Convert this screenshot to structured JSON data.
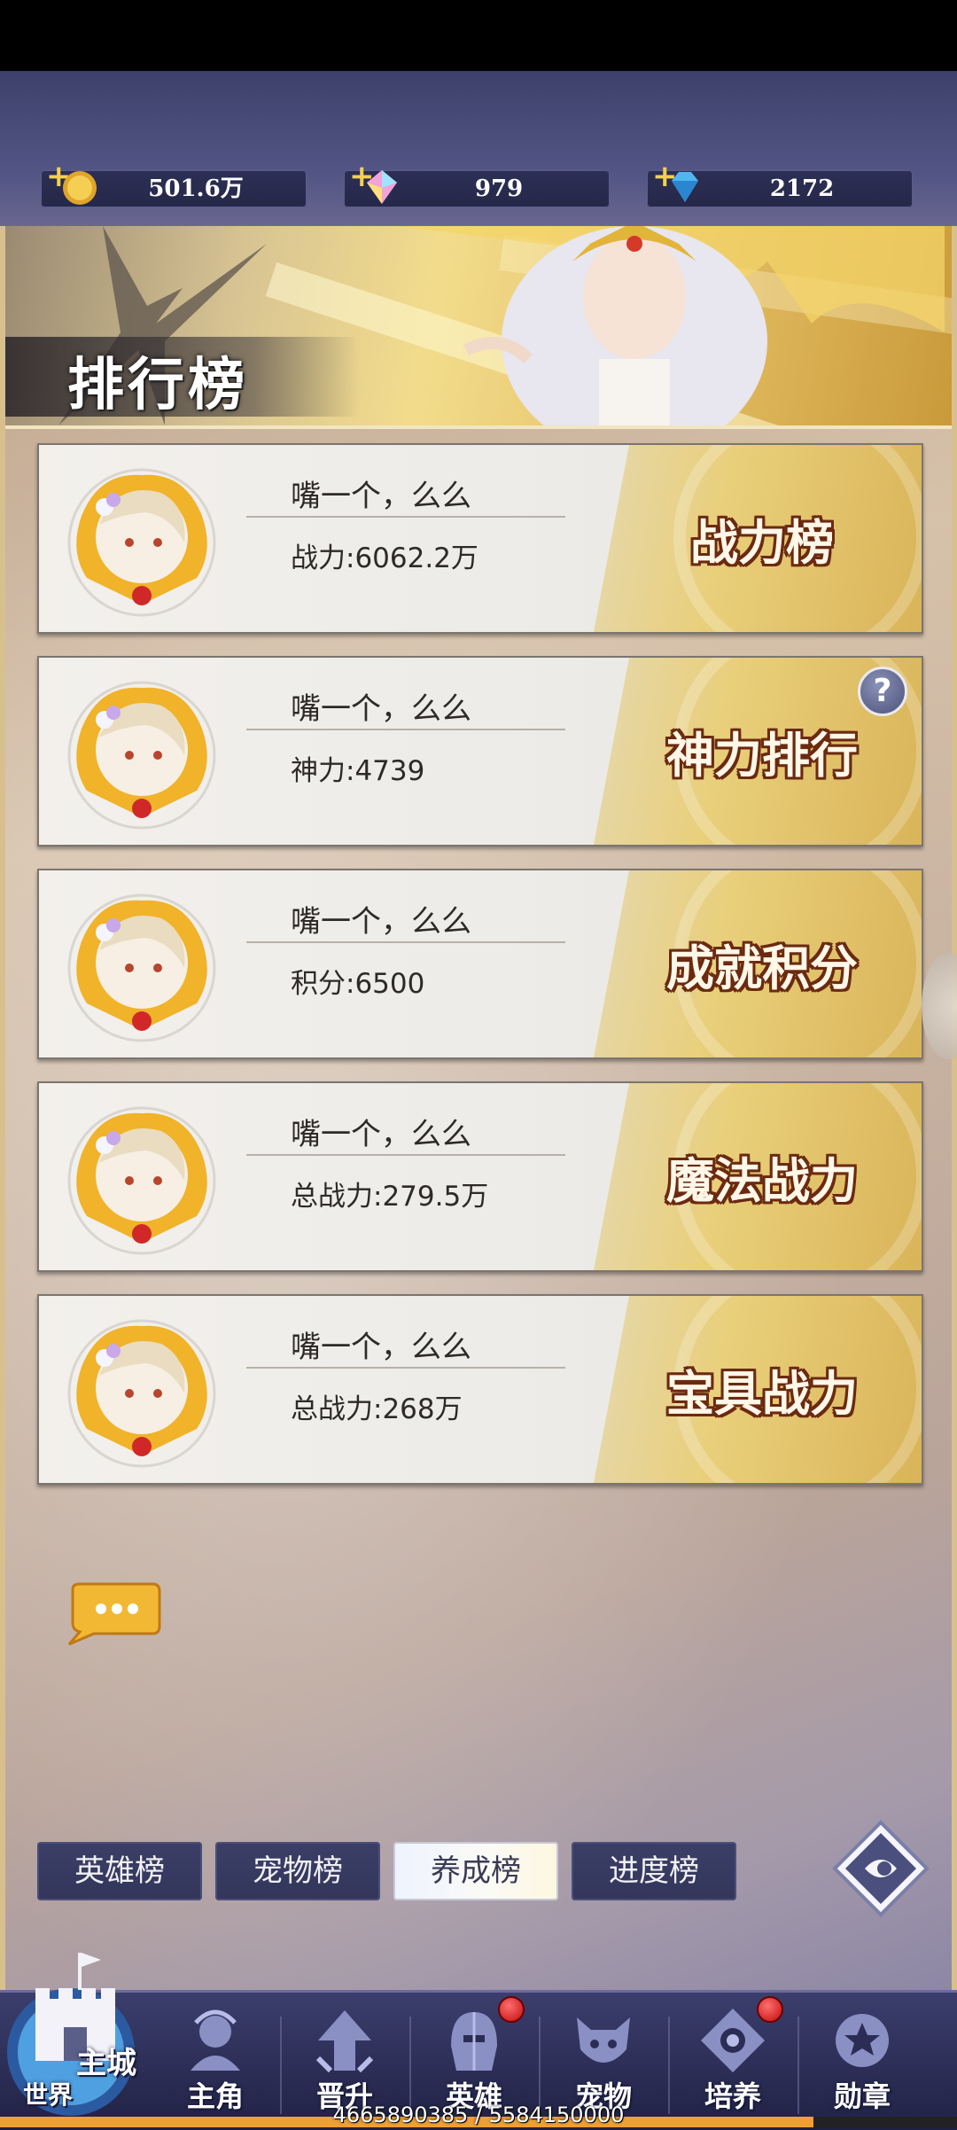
{
  "currencies": [
    {
      "icon": "gold-coin-icon",
      "value": "501.6万"
    },
    {
      "icon": "rainbow-crystal-icon",
      "value": "979"
    },
    {
      "icon": "blue-diamond-icon",
      "value": "2172"
    }
  ],
  "banner": {
    "title": "排行榜"
  },
  "rankings": [
    {
      "player": "嘴一个，么么",
      "stat": "战力:6062.2万",
      "title": "战力榜"
    },
    {
      "player": "嘴一个，么么",
      "stat": "神力:4739",
      "title": "神力排行"
    },
    {
      "player": "嘴一个，么么",
      "stat": "积分:6500",
      "title": "成就积分"
    },
    {
      "player": "嘴一个，么么",
      "stat": "总战力:279.5万",
      "title": "魔法战力"
    },
    {
      "player": "嘴一个，么么",
      "stat": "总战力:268万",
      "title": "宝具战力"
    }
  ],
  "help_label": "?",
  "tabs": [
    {
      "label": "英雄榜",
      "active": false
    },
    {
      "label": "宠物榜",
      "active": false
    },
    {
      "label": "养成榜",
      "active": true
    },
    {
      "label": "进度榜",
      "active": false
    }
  ],
  "nav": {
    "home_main": "主城",
    "home_world": "世界",
    "items": [
      {
        "label": "主角",
        "icon": "hero-profile-icon",
        "badge": false
      },
      {
        "label": "晋升",
        "icon": "promotion-icon",
        "badge": false
      },
      {
        "label": "英雄",
        "icon": "helmet-icon",
        "badge": true
      },
      {
        "label": "宠物",
        "icon": "pet-icon",
        "badge": false
      },
      {
        "label": "培养",
        "icon": "training-icon",
        "badge": true
      },
      {
        "label": "勋章",
        "icon": "medal-icon",
        "badge": false
      }
    ]
  },
  "memory_readout": "4665890385 / 5584150000",
  "loading_progress": 0.85,
  "colors": {
    "accent_gold": "#e9cf7a",
    "title_outline": "#6b2a10",
    "badge_red": "#d01010"
  }
}
